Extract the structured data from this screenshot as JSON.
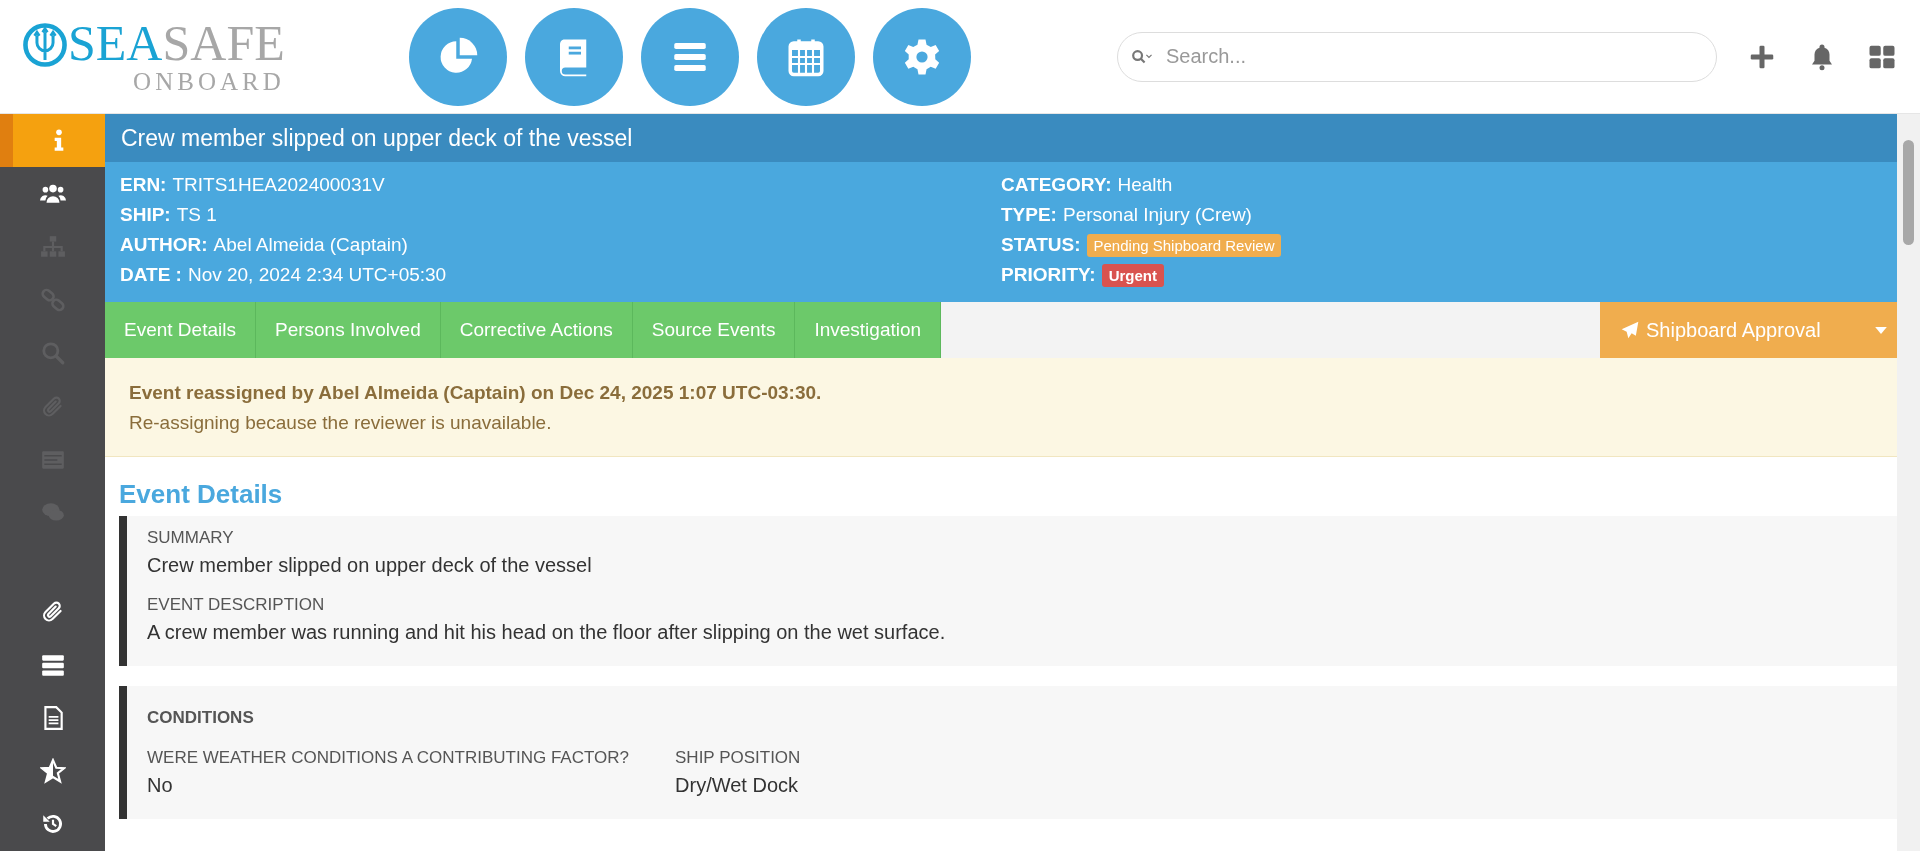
{
  "logo": {
    "word_1": "SEA",
    "word_2": "SAFE",
    "subtitle": "ONBOARD"
  },
  "nav_buttons": [
    {
      "kind": "chart"
    },
    {
      "kind": "book"
    },
    {
      "kind": "bars"
    },
    {
      "kind": "calendar"
    },
    {
      "kind": "gear"
    }
  ],
  "search": {
    "placeholder": "Search..."
  },
  "toolbar": [
    {
      "kind": "plus"
    },
    {
      "kind": "bell"
    },
    {
      "kind": "grid"
    }
  ],
  "sidebar": {
    "items": [
      {
        "kind": "info",
        "selected": true,
        "disabled": false
      },
      {
        "kind": "users",
        "selected": false,
        "disabled": false
      },
      {
        "kind": "sitemap",
        "selected": false,
        "disabled": true
      },
      {
        "kind": "link",
        "selected": false,
        "disabled": true
      },
      {
        "kind": "search",
        "selected": false,
        "disabled": true
      },
      {
        "kind": "paperclip",
        "selected": false,
        "disabled": true
      },
      {
        "kind": "list",
        "selected": false,
        "disabled": true
      },
      {
        "kind": "comments",
        "selected": false,
        "disabled": true
      }
    ],
    "items_bottom": [
      {
        "kind": "paperclip",
        "selected": false,
        "disabled": false
      },
      {
        "kind": "server",
        "selected": false,
        "disabled": false
      },
      {
        "kind": "document",
        "selected": false,
        "disabled": false
      },
      {
        "kind": "star",
        "selected": false,
        "disabled": false
      },
      {
        "kind": "history",
        "selected": false,
        "disabled": false
      }
    ]
  },
  "event": {
    "title": "Crew member slipped on upper deck of the vessel",
    "fields_left": [
      {
        "label": "ERN:",
        "value": "TRITS1HEA202400031V"
      },
      {
        "label": "SHIP:",
        "value": "TS 1"
      },
      {
        "label": "AUTHOR:",
        "value": "Abel Almeida (Captain)"
      },
      {
        "label": "DATE :",
        "value": "Nov 20, 2024 2:34 UTC+05:30"
      }
    ],
    "fields_right": [
      {
        "label": "CATEGORY:",
        "value": "Health"
      },
      {
        "label": "TYPE:",
        "value": "Personal Injury (Crew)"
      },
      {
        "label": "STATUS:",
        "badge": "Pending Shipboard Review",
        "color": "#f0ad4e"
      },
      {
        "label": "PRIORITY:",
        "badge": "Urgent",
        "color": "#d9534f"
      }
    ]
  },
  "tabs": [
    {
      "label": "Event Details"
    },
    {
      "label": "Persons Involved"
    },
    {
      "label": "Corrective Actions"
    },
    {
      "label": "Source Events"
    },
    {
      "label": "Investigation"
    }
  ],
  "action_button": {
    "label": "Shipboard Approval"
  },
  "alert": {
    "heading": "Event reassigned by Abel Almeida (Captain) on Dec 24, 2025 1:07 UTC-03:30.",
    "message": "Re-assigning because the reviewer is unavailable."
  },
  "section_title": "Event Details",
  "summary_card": {
    "fields": [
      {
        "label": "SUMMARY",
        "value": "Crew member slipped on upper deck of the vessel"
      },
      {
        "label": "EVENT DESCRIPTION",
        "value": "A crew member was running and hit his head on the floor after slipping on the wet surface."
      }
    ]
  },
  "conditions_card": {
    "title": "CONDITIONS",
    "fields": [
      {
        "label": "WERE WEATHER CONDITIONS A CONTRIBUTING FACTOR?",
        "value": "No"
      },
      {
        "label": "SHIP POSITION",
        "value": "Dry/Wet Dock"
      }
    ]
  }
}
